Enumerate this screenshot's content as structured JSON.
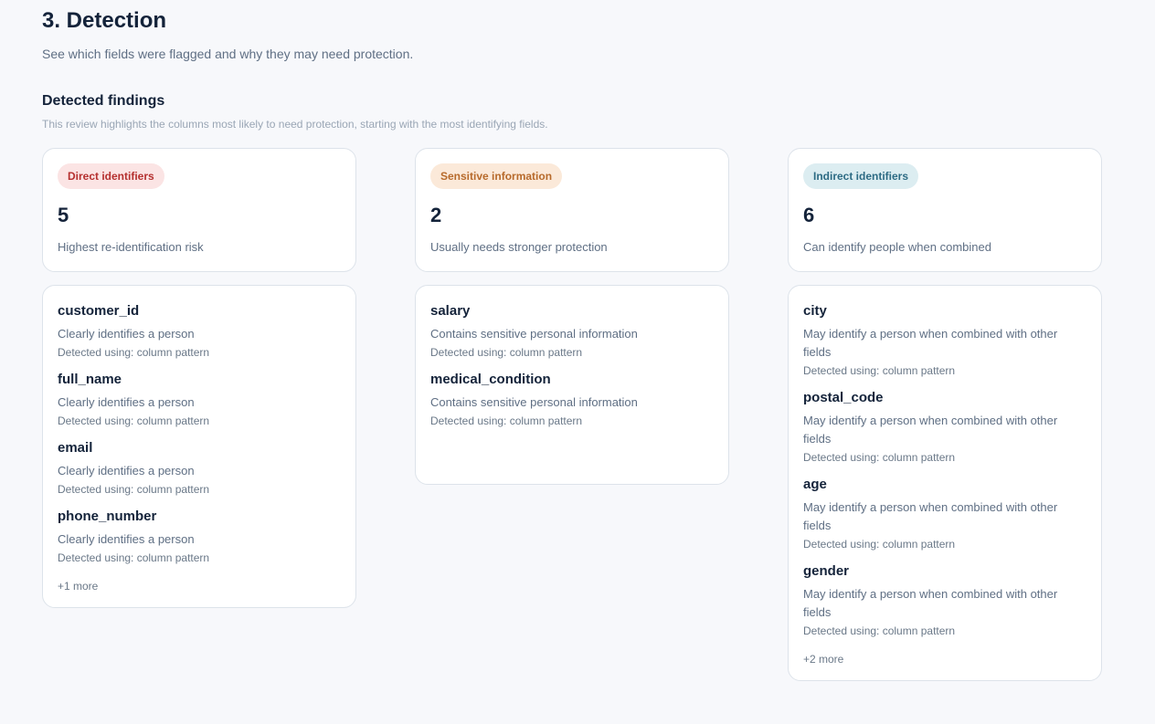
{
  "header": {
    "title": "3. Detection",
    "subtitle": "See which fields were flagged and why they may need protection."
  },
  "findings": {
    "title": "Detected findings",
    "description": "This review highlights the columns most likely to need protection, starting with the most identifying fields."
  },
  "categories": [
    {
      "badge": "Direct identifiers",
      "count": "5",
      "summary": "Highest re-identification risk",
      "fields": [
        {
          "name": "customer_id",
          "reason": "Clearly identifies a person",
          "method": "Detected using: column pattern"
        },
        {
          "name": "full_name",
          "reason": "Clearly identifies a person",
          "method": "Detected using: column pattern"
        },
        {
          "name": "email",
          "reason": "Clearly identifies a person",
          "method": "Detected using: column pattern"
        },
        {
          "name": "phone_number",
          "reason": "Clearly identifies a person",
          "method": "Detected using: column pattern"
        }
      ],
      "more": "+1 more"
    },
    {
      "badge": "Sensitive information",
      "count": "2",
      "summary": "Usually needs stronger protection",
      "fields": [
        {
          "name": "salary",
          "reason": "Contains sensitive personal information",
          "method": "Detected using: column pattern"
        },
        {
          "name": "medical_condition",
          "reason": "Contains sensitive personal information",
          "method": "Detected using: column pattern"
        }
      ]
    },
    {
      "badge": "Indirect identifiers",
      "count": "6",
      "summary": "Can identify people when combined",
      "fields": [
        {
          "name": "city",
          "reason": "May identify a person when combined with other fields",
          "method": "Detected using: column pattern"
        },
        {
          "name": "postal_code",
          "reason": "May identify a person when combined with other fields",
          "method": "Detected using: column pattern"
        },
        {
          "name": "age",
          "reason": "May identify a person when combined with other fields",
          "method": "Detected using: column pattern"
        },
        {
          "name": "gender",
          "reason": "May identify a person when combined with other fields",
          "method": "Detected using: column pattern"
        }
      ],
      "more": "+2 more"
    }
  ],
  "colors": {
    "direct": "#b5302f",
    "sensitive": "#b76a2b",
    "indirect": "#2d6b84"
  }
}
